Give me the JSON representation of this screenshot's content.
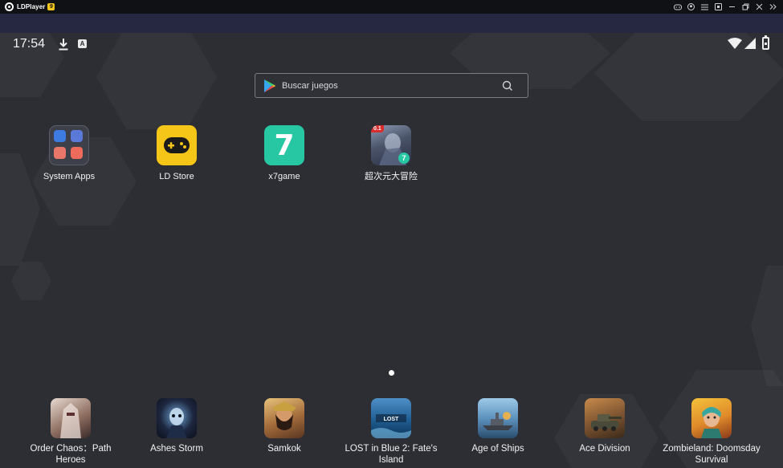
{
  "titlebar": {
    "app_name": "LDPlayer",
    "version_badge": "9",
    "controls": [
      "gamepad-icon",
      "user-circle-icon",
      "menu-icon",
      "screen-record-icon",
      "minimize-icon",
      "restore-icon",
      "close-icon",
      "expand-sidebar-icon"
    ]
  },
  "statusbar": {
    "time": "17:54",
    "notif_letter": "A"
  },
  "search": {
    "placeholder": "Buscar juegos"
  },
  "desktop": {
    "apps": [
      {
        "label": "System Apps",
        "icon": "system-apps-folder-icon"
      },
      {
        "label": "LD Store",
        "icon": "gamepad-icon"
      },
      {
        "label": "x7game",
        "icon": "x7game-icon",
        "glyph": "7"
      },
      {
        "label": "超次元大冒险",
        "icon": "game-art-icon",
        "badge": "0.1",
        "corner_badge": "7"
      }
    ],
    "page_indicator": {
      "pages": 1,
      "current": 1
    }
  },
  "dock": {
    "apps": [
      {
        "label_line1": "Order Chaos：Path",
        "label_line2": "Heroes"
      },
      {
        "label_line1": "Ashes Storm",
        "label_line2": ""
      },
      {
        "label_line1": "Samkok",
        "label_line2": ""
      },
      {
        "label_line1": "LOST in Blue 2: Fate's",
        "label_line2": "Island"
      },
      {
        "label_line1": "Age of Ships",
        "label_line2": ""
      },
      {
        "label_line1": "Ace Division",
        "label_line2": ""
      },
      {
        "label_line1": "Zombieland: Doomsday",
        "label_line2": "Survival"
      }
    ]
  },
  "colors": {
    "titlebar_bg": "#101114",
    "toolbar_bg": "#252840",
    "screen_bg": "#2c2e34",
    "ldstore_yellow": "#f5c518",
    "x7_green": "#27c7a3",
    "badge_yellow": "#f3c51b"
  }
}
